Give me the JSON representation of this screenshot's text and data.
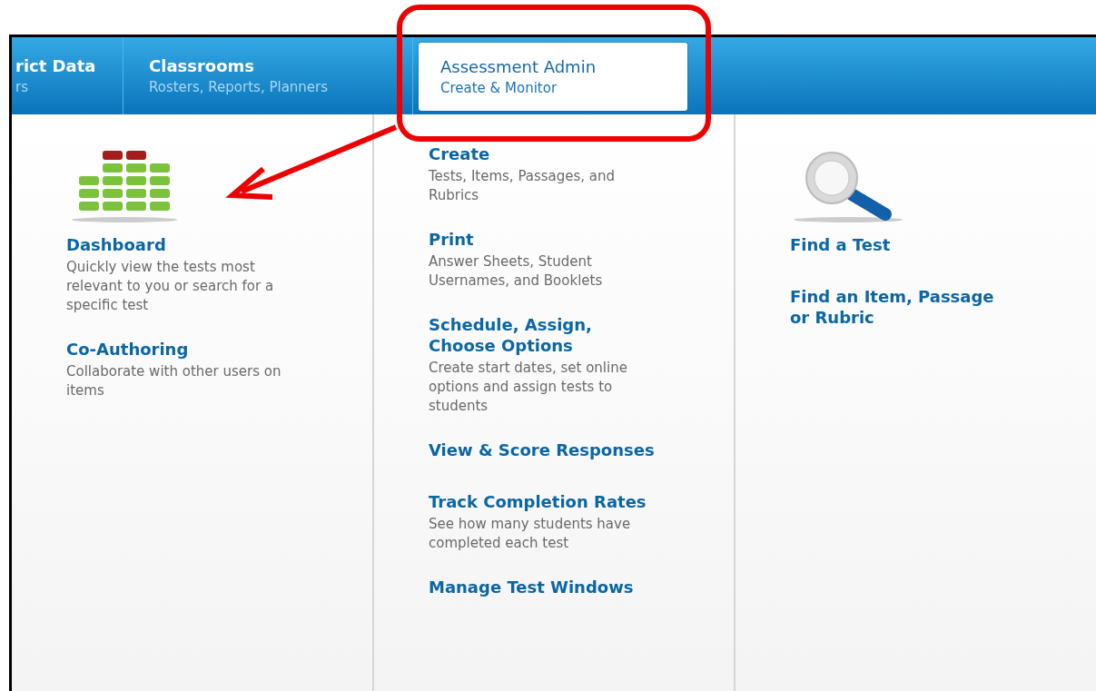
{
  "nav": {
    "tabs": [
      {
        "title": "rict Data",
        "subtitle": "rs",
        "selected": false
      },
      {
        "title": "Classrooms",
        "subtitle": "Rosters, Reports, Planners",
        "selected": false
      },
      {
        "title": "Assessment Admin",
        "subtitle": "Create & Monitor",
        "selected": true
      }
    ]
  },
  "columns": [
    {
      "items": [
        {
          "title": "Dashboard",
          "description": "Quickly view the tests most relevant to you or search for a specific test"
        },
        {
          "title": "Co-Authoring",
          "description": "Collaborate with other users on items"
        }
      ]
    },
    {
      "items": [
        {
          "title": "Create",
          "description": "Tests, Items, Passages, and Rubrics"
        },
        {
          "title": "Print",
          "description": "Answer Sheets, Student Usernames, and Booklets"
        },
        {
          "title": "Schedule, Assign, Choose Options",
          "description": "Create start dates, set online options and assign tests to students"
        },
        {
          "title": "View & Score Responses"
        },
        {
          "title": "Track Completion Rates",
          "description": "See how many students have completed each test"
        },
        {
          "title": "Manage Test Windows"
        }
      ]
    },
    {
      "items": [
        {
          "title": "Find a Test"
        },
        {
          "title": "Find an Item, Passage or Rubric"
        }
      ]
    }
  ]
}
